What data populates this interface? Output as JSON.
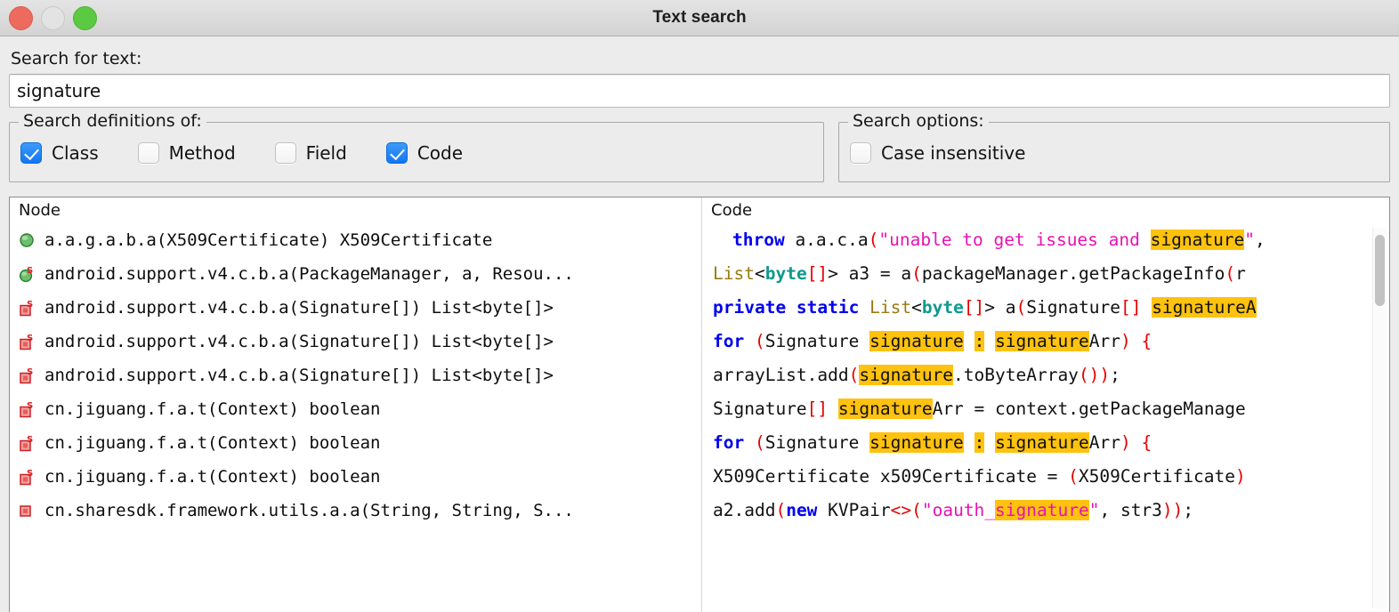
{
  "window": {
    "title": "Text search",
    "traffic_lights": [
      {
        "name": "close",
        "color": "#ec6a5e"
      },
      {
        "name": "minimize",
        "color": "#e3e3e3"
      },
      {
        "name": "maximize",
        "color": "#5bc942"
      }
    ]
  },
  "search": {
    "label": "Search for text:",
    "value": "signature",
    "placeholder": ""
  },
  "definitions_group": {
    "title": "Search definitions of:",
    "checkboxes": [
      {
        "label": "Class",
        "checked": true
      },
      {
        "label": "Method",
        "checked": false
      },
      {
        "label": "Field",
        "checked": false
      },
      {
        "label": "Code",
        "checked": true
      }
    ]
  },
  "options_group": {
    "title": "Search options:",
    "checkboxes": [
      {
        "label": "Case insensitive",
        "checked": false
      }
    ]
  },
  "node_panel": {
    "header": "Node",
    "rows": [
      {
        "icon": "green-sphere-icon",
        "text": "a.a.g.a.b.a(X509Certificate) X509Certificate"
      },
      {
        "icon": "green-sphere-static-icon",
        "text": "android.support.v4.c.b.a(PackageManager, a, Resou..."
      },
      {
        "icon": "red-square-static-icon",
        "text": "android.support.v4.c.b.a(Signature[]) List<byte[]>"
      },
      {
        "icon": "red-square-static-icon",
        "text": "android.support.v4.c.b.a(Signature[]) List<byte[]>"
      },
      {
        "icon": "red-square-static-icon",
        "text": "android.support.v4.c.b.a(Signature[]) List<byte[]>"
      },
      {
        "icon": "red-square-static-icon",
        "text": "cn.jiguang.f.a.t(Context) boolean"
      },
      {
        "icon": "red-square-static-icon",
        "text": "cn.jiguang.f.a.t(Context) boolean"
      },
      {
        "icon": "red-square-static-icon",
        "text": "cn.jiguang.f.a.t(Context) boolean"
      },
      {
        "icon": "red-square-icon",
        "text": "cn.sharesdk.framework.utils.a.a(String, String, S..."
      }
    ]
  },
  "code_panel": {
    "header": "Code",
    "highlight_term": "signature",
    "lines": [
      "throw a.a.c.a(\"unable to get issues and signature\",",
      "List<byte[]> a3 = a(packageManager.getPackageInfo(r",
      "private static List<byte[]> a(Signature[] signatureA",
      "for (Signature signature : signatureArr) {",
      "arrayList.add(signature.toByteArray());",
      "Signature[] signatureArr = context.getPackageManage",
      "for (Signature signature : signatureArr) {",
      "X509Certificate x509Certificate = (X509Certificate)",
      "a2.add(new KVPair<>(\"oauth_signature\", str3));"
    ]
  },
  "colors": {
    "keyword": "#0000ef",
    "type": "#9a7a12",
    "primitive": "#0f9a8e",
    "punctuation": "#e50000",
    "string": "#e612b4",
    "highlight": "#ffc20e",
    "accent": "#1176f2"
  }
}
